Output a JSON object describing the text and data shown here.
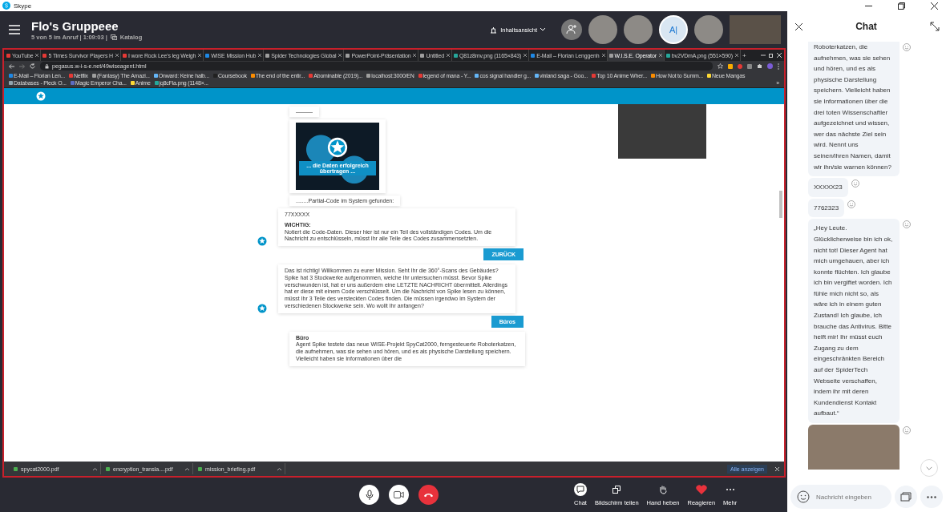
{
  "app_title": "Skype",
  "call": {
    "title": "Flo's Gruppeee",
    "status": "5 von 5 im Anruf | 1:09:03 |",
    "catalog": "Katalog",
    "view_mode": "Inhaltsansicht",
    "participants": [
      {
        "kind": "photo",
        "selected": false
      },
      {
        "kind": "photo",
        "selected": false
      },
      {
        "kind": "initials",
        "initials": "A|",
        "selected": true
      },
      {
        "kind": "photo",
        "selected": false
      },
      {
        "kind": "video",
        "selected": false
      }
    ]
  },
  "browser": {
    "tabs": [
      {
        "label": "YouTube",
        "selected": false,
        "color": "#e53935"
      },
      {
        "label": "5 Times Survivor Players H",
        "selected": false,
        "color": "#e53935"
      },
      {
        "label": "I wore Rock Lee's leg Weigh",
        "selected": false,
        "color": "#e53935"
      },
      {
        "label": "WISE Mission Hub",
        "selected": false,
        "color": "#1e88e5"
      },
      {
        "label": "Spider Technologies Global",
        "selected": false,
        "color": "#9e9e9e"
      },
      {
        "label": "PowerPoint-Präsentation",
        "selected": false,
        "color": "#9e9e9e"
      },
      {
        "label": "Untitled",
        "selected": false,
        "color": "#9e9e9e"
      },
      {
        "label": "Q81z8mv.png (1165×843)",
        "selected": false,
        "color": "#26a69a"
      },
      {
        "label": "E-Mail – Florian Lenggenh",
        "selected": false,
        "color": "#1e88e5"
      },
      {
        "label": "W.I.S.E. Operator",
        "selected": true,
        "color": "#9e9e9e"
      },
      {
        "label": "bv2VDmA.png (551×590)",
        "selected": false,
        "color": "#26a69a"
      }
    ],
    "new_tab": "+",
    "url": "pegasus.w-i-s-e.net/49wiseagent.html",
    "bookmarks": [
      {
        "label": "E-Mail – Florian Len...",
        "color": "#1e88e5"
      },
      {
        "label": "Netflix",
        "color": "#e53935"
      },
      {
        "label": "(Fantasy) The Amazi...",
        "color": "#9e9e9e"
      },
      {
        "label": "Onward: Keine halb...",
        "color": "#64b5f6"
      },
      {
        "label": "Coursebook",
        "color": "#212121"
      },
      {
        "label": "The end of the entir...",
        "color": "#fb8c00"
      },
      {
        "label": "Abominable (2019)...",
        "color": "#e53935"
      },
      {
        "label": "localhost:3000/EN",
        "color": "#9e9e9e"
      },
      {
        "label": "legend of mana - Y...",
        "color": "#e53935"
      },
      {
        "label": "cos signal handler g...",
        "color": "#64b5f6"
      },
      {
        "label": "vinland saga - Goo...",
        "color": "#64b5f6"
      },
      {
        "label": "Top 10 Anime Wher...",
        "color": "#e53935"
      },
      {
        "label": "How Not to Summ...",
        "color": "#fb8c00"
      },
      {
        "label": "Neue Mangas",
        "color": "#fdd835"
      },
      {
        "label": "Databases - Pleck O...",
        "color": "#90a4ae"
      },
      {
        "label": "Magic Emperor Cha...",
        "color": "#5c6bc0"
      },
      {
        "label": "Anime",
        "color": "#fdd835"
      },
      {
        "label": "jq8cFla.png (1148×...",
        "color": "#26a69a"
      }
    ],
    "bookmarks_more": "»",
    "downloads": [
      "spycat2000.pdf",
      "encryption_transla....pdf",
      "mission_briefing.pdf"
    ],
    "show_all": "Alle anzeigen"
  },
  "page": {
    "messages": [
      {
        "kind": "bot",
        "text": "———"
      },
      {
        "kind": "image",
        "caption": "... die Daten erfolgreich übertragen ..."
      },
      {
        "kind": "bot",
        "text": "........Partial-Code im System gefunden:"
      },
      {
        "kind": "card",
        "avatar": true,
        "code": "77XXXXX",
        "heading": "WICHTIG:",
        "text": "Notiert die Code-Daten. Dieser hier ist nur ein Teil des vollständigen Codes. Um die Nachricht zu entschlüsseln, müsst Ihr alle Teile des Codes zusammensetzten."
      },
      {
        "kind": "reply",
        "text": "ZURÜCK"
      },
      {
        "kind": "card",
        "avatar": true,
        "text": "Das ist richtig! Willkommen zu eurer Mission. Seht Ihr die 360°-Scans des Gebäudes? Spike hat 3 Stockwerke aufgenommen, welche Ihr untersuchen müsst. Bevor Spike verschwunden ist, hat er uns außerdem eine LETZTE NACHRICHT übermittelt. Allerdings hat er diese mit einem Code verschlüsselt. Um die Nachricht von Spike lesen zu können, müsst Ihr 3 Teile des versteckten Codes finden. Die müssen irgendwo im System der verschiedenen Stockwerke sein. Wo wollt Ihr anfangen?"
      },
      {
        "kind": "reply",
        "text": "Büros"
      },
      {
        "kind": "card",
        "avatar": false,
        "heading": "Büro",
        "text": "Agent Spike testete das neue WISE-Projekt SpyCat2000, ferngesteuerte Roboterkatzen, die aufnehmen, was sie sehen und hören, und es als physische Darstellung speichern. Vielleicht haben sie Informationen über die"
      }
    ]
  },
  "controls": [
    {
      "label": "Chat",
      "kind": "chat"
    },
    {
      "label": "Bildschirm teilen",
      "kind": "share"
    },
    {
      "label": "Hand heben",
      "kind": "hand"
    },
    {
      "label": "Reagieren",
      "kind": "heart"
    },
    {
      "label": "Mehr",
      "kind": "more"
    }
  ],
  "chat": {
    "title": "Chat",
    "messages": [
      {
        "kind": "text",
        "text": "Roboterkatzen, die aufnehmen, was sie sehen und hören, und es als physische Darstellung speichern. Vielleicht haben sie Informationen über die drei toten Wissenschaftler aufgezeichnet und wissen, wer das nächste Ziel sein wird. Nennt uns seinen/ihren Namen, damit wir ihn/sie warnen können?"
      },
      {
        "kind": "text",
        "text": "XXXXX23"
      },
      {
        "kind": "text",
        "text": "7762323"
      },
      {
        "kind": "text",
        "text": "„Hey Leute. Glücklicherweise bin ich ok, nicht tot! Dieser Agent hat mich umgehauen, aber ich konnte flüchten. Ich glaube ich bin vergiftet worden. Ich fühle mich nicht so, als wäre ich in einem guten Zustand! Ich glaube, ich brauche das Antivirus. Bitte helft mir! Ihr müsst euch Zugang zu dem eingeschränkten Bereich auf der SpiderTech Webseite verschaffen, indem ihr mit deren Kundendienst Kontakt aufbaut.“"
      },
      {
        "kind": "photo"
      }
    ],
    "placeholder": "Nachricht eingeben"
  }
}
